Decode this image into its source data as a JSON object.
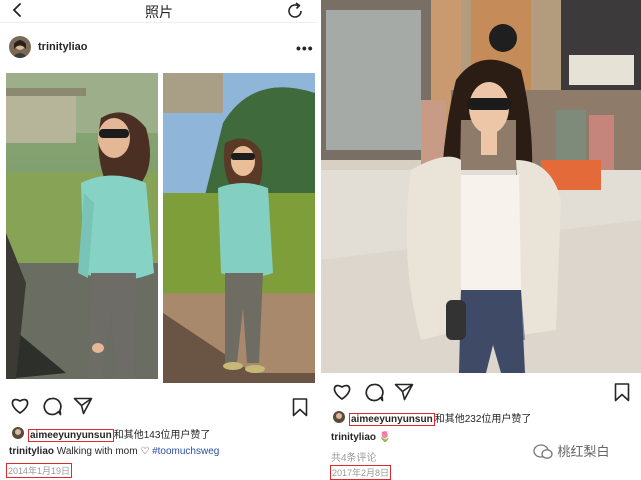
{
  "left_post": {
    "nav_title": "照片",
    "author": "trinityliao",
    "more": "•••",
    "liker_username": "aimeeyunyunsun",
    "likes_suffix": "和其他143位用户赞了",
    "caption_user": "trinityliao",
    "caption_text": "Walking with mom ♡",
    "hashtag": "#toomuchsweg",
    "date": "2014年1月19日"
  },
  "right_post": {
    "liker_username": "aimeeyunyunsun",
    "likes_suffix": "和其他232位用户赞了",
    "caption_user": "trinityliao",
    "caption_emoji": "🌷",
    "comments": "共4条评论",
    "date": "2017年2月8日"
  },
  "watermark": "桃红梨白",
  "colors": {
    "highlight_box": "#e0292b",
    "hashtag": "#2b4ea0",
    "date_gray": "#999999"
  }
}
